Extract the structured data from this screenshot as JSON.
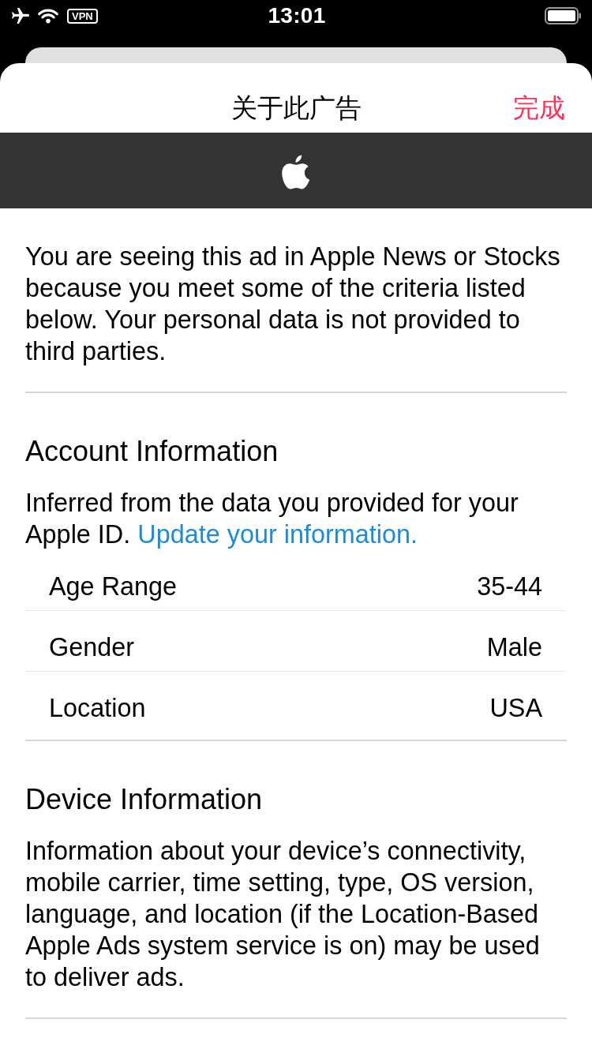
{
  "status_bar": {
    "vpn_badge": "VPN",
    "time": "13:01"
  },
  "sheet": {
    "title": "关于此广告",
    "done_button": "完成"
  },
  "intro": "You are seeing this ad in Apple News or Stocks because you meet some of the criteria listed below. Your personal data is not provided to third parties.",
  "sections": [
    {
      "heading": "Account Information",
      "description": "Inferred from the data you provided for your Apple ID.",
      "link": "Update your information.",
      "rows": [
        {
          "label": "Age Range",
          "value": "35-44"
        },
        {
          "label": "Gender",
          "value": "Male"
        },
        {
          "label": "Location",
          "value": "USA"
        }
      ]
    },
    {
      "heading": "Device Information",
      "description": "Information about your device’s connectivity, mobile carrier, time setting, type, OS version, language, and location (if the Location-Based Apple Ads system service is on) may be used to deliver ads."
    }
  ]
}
